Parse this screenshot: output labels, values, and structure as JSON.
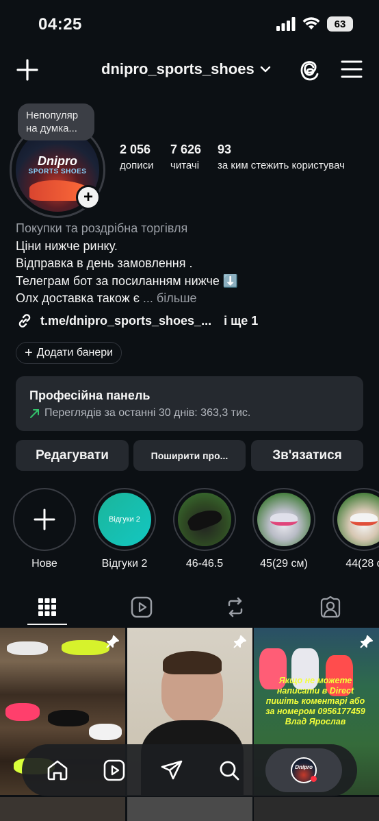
{
  "status": {
    "time": "04:25",
    "battery": "63"
  },
  "header": {
    "username": "dnipro_sports_shoes"
  },
  "profile": {
    "note": "Непопуляр на думка...",
    "avatar_logo": "Dnipro",
    "avatar_sub": "SPORTS SHOES",
    "stats": [
      {
        "num": "2 056",
        "label": "дописи"
      },
      {
        "num": "7 626",
        "label": "читачі"
      },
      {
        "num": "93",
        "label": "за ким стежить користувач"
      }
    ],
    "category": "Покупки та роздрібна торгівля",
    "bio": [
      "Ціни нижче ринку.",
      "Відправка в день замовлення .",
      "Телеграм бот за посиланням нижче ⬇️",
      "Олх доставка також є"
    ],
    "more": "... більше",
    "link": "t.me/dnipro_sports_shoes_...",
    "link_extra": "і ще 1",
    "add_banners": "Додати банери"
  },
  "pro_panel": {
    "title": "Професійна панель",
    "subtitle": "Переглядів за останні 30 днів: 363,3 тис."
  },
  "actions": {
    "edit": "Редагувати",
    "share": "Поширити про...",
    "contact": "Зв'язатися"
  },
  "highlights": [
    {
      "label": "Нове",
      "inner": ""
    },
    {
      "label": "Відгуки 2",
      "inner": "Відгуки 2"
    },
    {
      "label": "46-46.5",
      "inner": ""
    },
    {
      "label": "45(29 см)",
      "inner": ""
    },
    {
      "label": "44(28 с",
      "inner": ""
    }
  ],
  "grid_posts": [
    {
      "caption": ""
    },
    {
      "caption": ""
    },
    {
      "caption": "Якщо не можете написати в Direct пишіть коментарі або за номером 0956177459 Влад Ярослав"
    }
  ],
  "nav_profile_label": "Dnipro"
}
